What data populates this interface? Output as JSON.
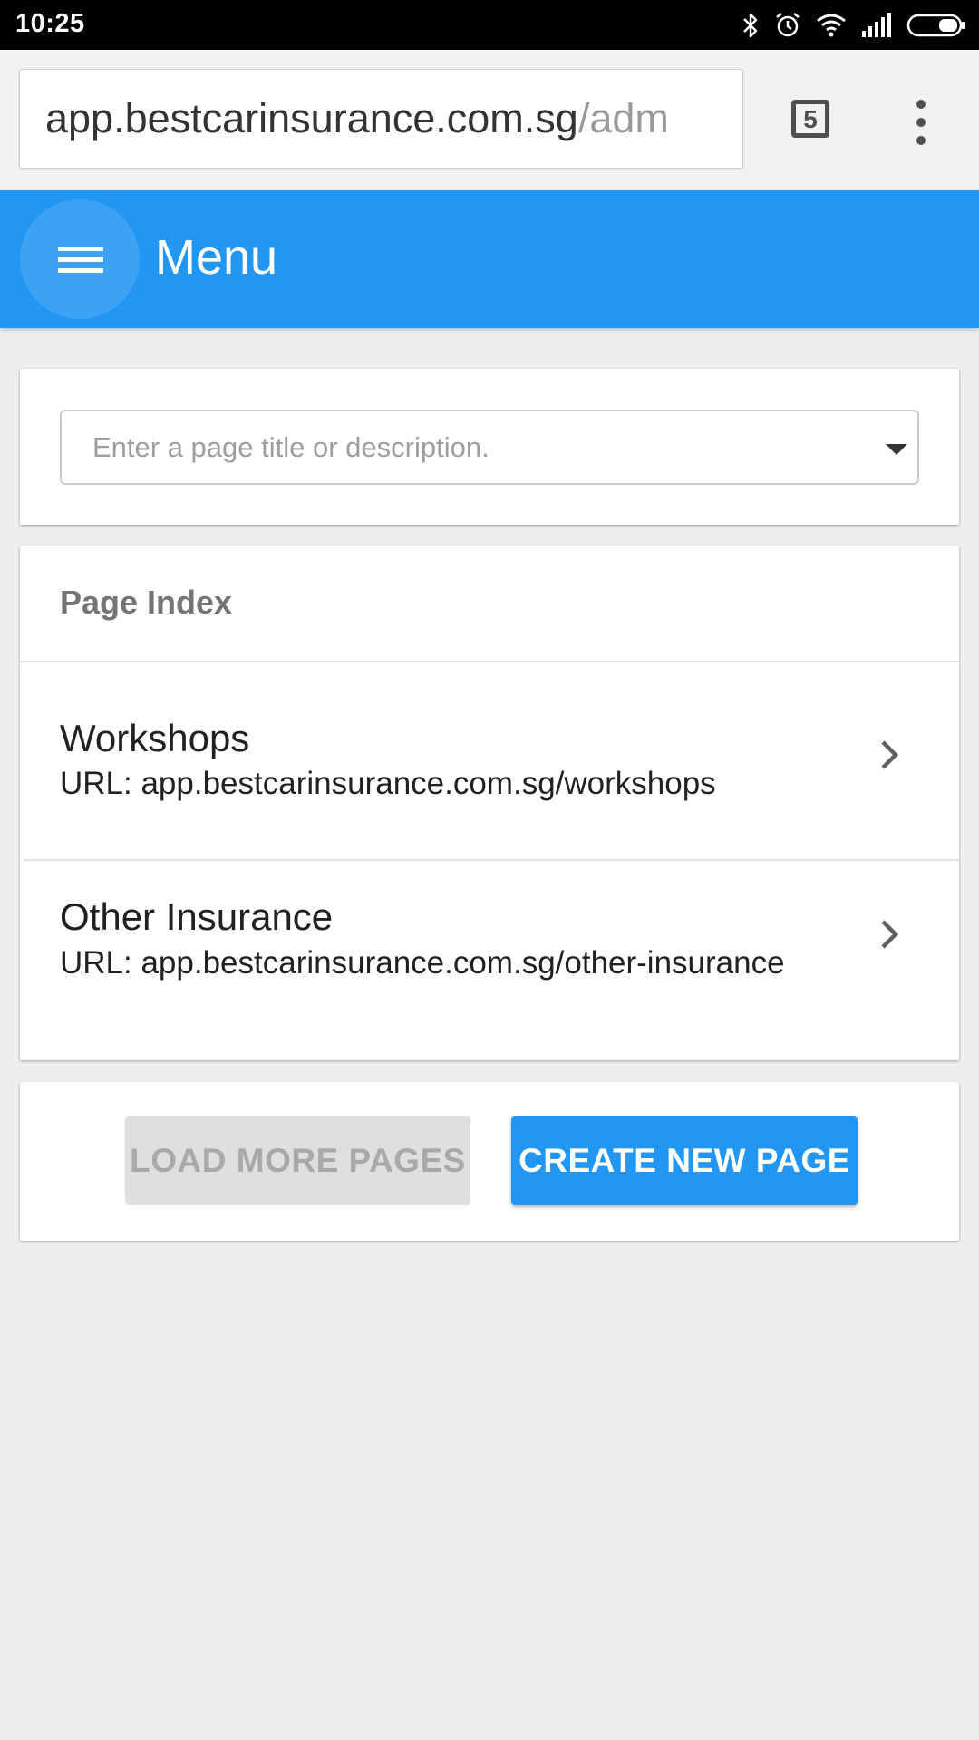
{
  "status_bar": {
    "time": "10:25",
    "icons": [
      "bluetooth-icon",
      "alarm-icon",
      "wifi-icon",
      "signal-icon",
      "battery-icon"
    ]
  },
  "browser": {
    "url_host": "app.bestcarinsurance.com.sg",
    "url_path": "/adm",
    "tab_count": "5"
  },
  "app_bar": {
    "title": "Menu",
    "color": "#2196f3"
  },
  "search": {
    "placeholder": "Enter a page title or description.",
    "value": ""
  },
  "page_index": {
    "header": "Page Index",
    "items": [
      {
        "title": "Workshops",
        "url": "URL: app.bestcarinsurance.com.sg/workshops"
      },
      {
        "title": "Other Insurance",
        "url": "URL: app.bestcarinsurance.com.sg/other-insurance"
      }
    ]
  },
  "actions": {
    "load_more_label": "LOAD MORE PAGES",
    "create_label": "CREATE NEW PAGE"
  },
  "colors": {
    "accent": "#2196f3",
    "background": "#eeeeee",
    "disabled": "#dfdfdf"
  }
}
